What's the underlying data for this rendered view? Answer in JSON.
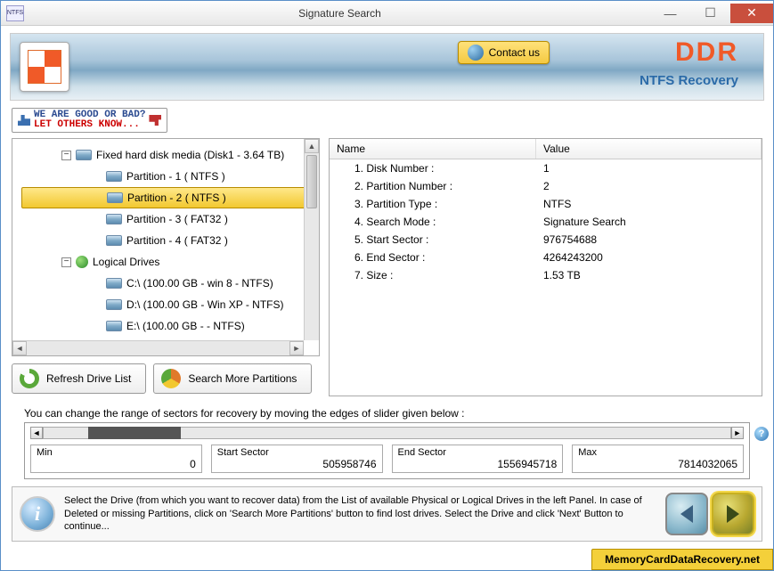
{
  "window": {
    "title": "Signature Search"
  },
  "header": {
    "contact_label": "Contact us",
    "brand": "DDR",
    "tagline": "NTFS Recovery"
  },
  "feedback": {
    "line1": "WE ARE GOOD OR BAD?",
    "line2": "LET OTHERS KNOW..."
  },
  "tree": {
    "disk_label": "Fixed hard disk media (Disk1 - 3.64 TB)",
    "partitions": [
      "Partition - 1 ( NTFS )",
      "Partition - 2 ( NTFS )",
      "Partition - 3 ( FAT32 )",
      "Partition - 4 ( FAT32 )"
    ],
    "selected_index": 1,
    "logical_label": "Logical Drives",
    "logical": [
      "C:\\ (100.00 GB - win 8 - NTFS)",
      "D:\\ (100.00 GB - Win XP - NTFS)",
      "E:\\ (100.00 GB -  - NTFS)"
    ]
  },
  "buttons": {
    "refresh": "Refresh Drive List",
    "search_more": "Search More Partitions"
  },
  "info": {
    "col_name": "Name",
    "col_value": "Value",
    "rows": [
      {
        "name": "1. Disk Number :",
        "value": "1"
      },
      {
        "name": "2. Partition Number :",
        "value": "2"
      },
      {
        "name": "3. Partition Type :",
        "value": "NTFS"
      },
      {
        "name": "4. Search Mode :",
        "value": "Signature Search"
      },
      {
        "name": "5. Start Sector :",
        "value": "976754688"
      },
      {
        "name": "6. End Sector :",
        "value": "4264243200"
      },
      {
        "name": "7. Size :",
        "value": "1.53 TB"
      }
    ]
  },
  "slider": {
    "caption": "You can change the range of sectors for recovery by moving the edges of slider given below :",
    "fields": [
      {
        "label": "Min",
        "value": "0"
      },
      {
        "label": "Start Sector",
        "value": "505958746"
      },
      {
        "label": "End Sector",
        "value": "1556945718"
      },
      {
        "label": "Max",
        "value": "7814032065"
      }
    ],
    "thumb_left_pct": 6.5,
    "thumb_width_pct": 13.5
  },
  "footer": {
    "text": "Select the Drive (from which you want to recover data) from the List of available Physical or Logical Drives in the left Panel. In case of Deleted or missing Partitions, click on 'Search More Partitions' button to find lost drives. Select the Drive and click 'Next' Button to continue..."
  },
  "watermark": "MemoryCardDataRecovery.net"
}
